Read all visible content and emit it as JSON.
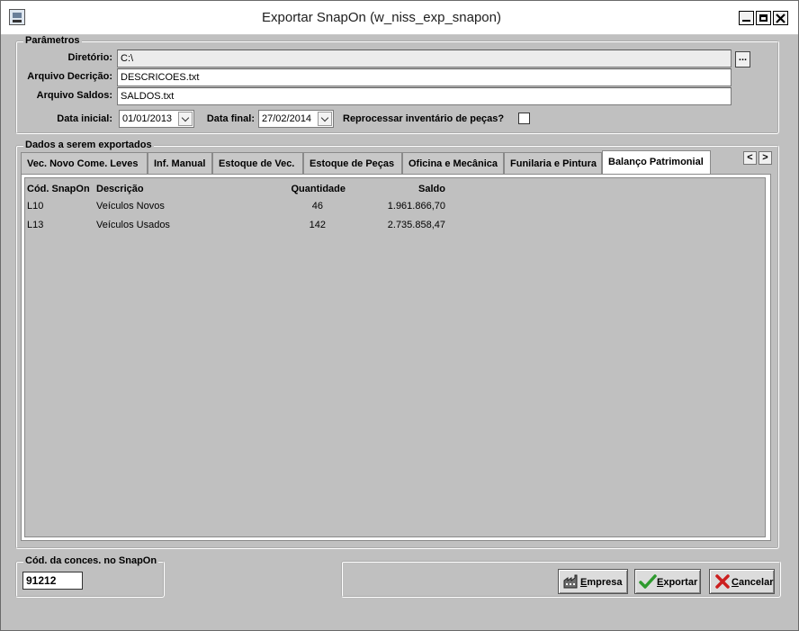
{
  "window": {
    "title": "Exportar SnapOn (w_niss_exp_snapon)"
  },
  "parametros": {
    "group_label": "Parâmetros",
    "diretorio_label": "Diretório:",
    "diretorio_value": "C:\\",
    "browse_label": "...",
    "arquivo_decricao_label": "Arquivo Decrição:",
    "arquivo_decricao_value": "DESCRICOES.txt",
    "arquivo_saldos_label": "Arquivo Saldos:",
    "arquivo_saldos_value": "SALDOS.txt",
    "data_inicial_label": "Data inicial:",
    "data_inicial_value": "01/01/2013",
    "data_final_label": "Data final:",
    "data_final_value": "27/02/2014",
    "reprocessar_label": "Reprocessar inventário de peças?",
    "reprocessar_checked": false
  },
  "dados": {
    "group_label": "Dados a serem exportados",
    "tabs": [
      {
        "label": "Vec. Novo Come. Leves"
      },
      {
        "label": "Inf. Manual"
      },
      {
        "label": "Estoque de Vec."
      },
      {
        "label": "Estoque de Peças"
      },
      {
        "label": "Oficina e Mecânica"
      },
      {
        "label": "Funilaria e Pintura"
      },
      {
        "label": "Balanço Patrimonial"
      }
    ],
    "active_tab": "Balanço Patrimonial",
    "scroll_left": "<",
    "scroll_right": ">",
    "columns": [
      "Cód. SnapOn",
      "Descrição",
      "Quantidade",
      "Saldo"
    ],
    "rows": [
      [
        "L10",
        "Veículos Novos",
        "46",
        "1.961.866,70"
      ],
      [
        "L13",
        "Veículos Usados",
        "142",
        "2.735.858,47"
      ]
    ]
  },
  "cod_conces": {
    "group_label": "Cód. da conces. no SnapOn",
    "value": "91212"
  },
  "buttons": {
    "empresa": {
      "first": "E",
      "rest": "mpresa",
      "icon": "factory-icon"
    },
    "exportar": {
      "first": "E",
      "rest": "xportar",
      "icon": "checkmark-icon",
      "color": "#2e9a2e"
    },
    "cancelar": {
      "first": "C",
      "rest": "ancelar",
      "icon": "x-icon",
      "color": "#cc1f1f"
    }
  }
}
